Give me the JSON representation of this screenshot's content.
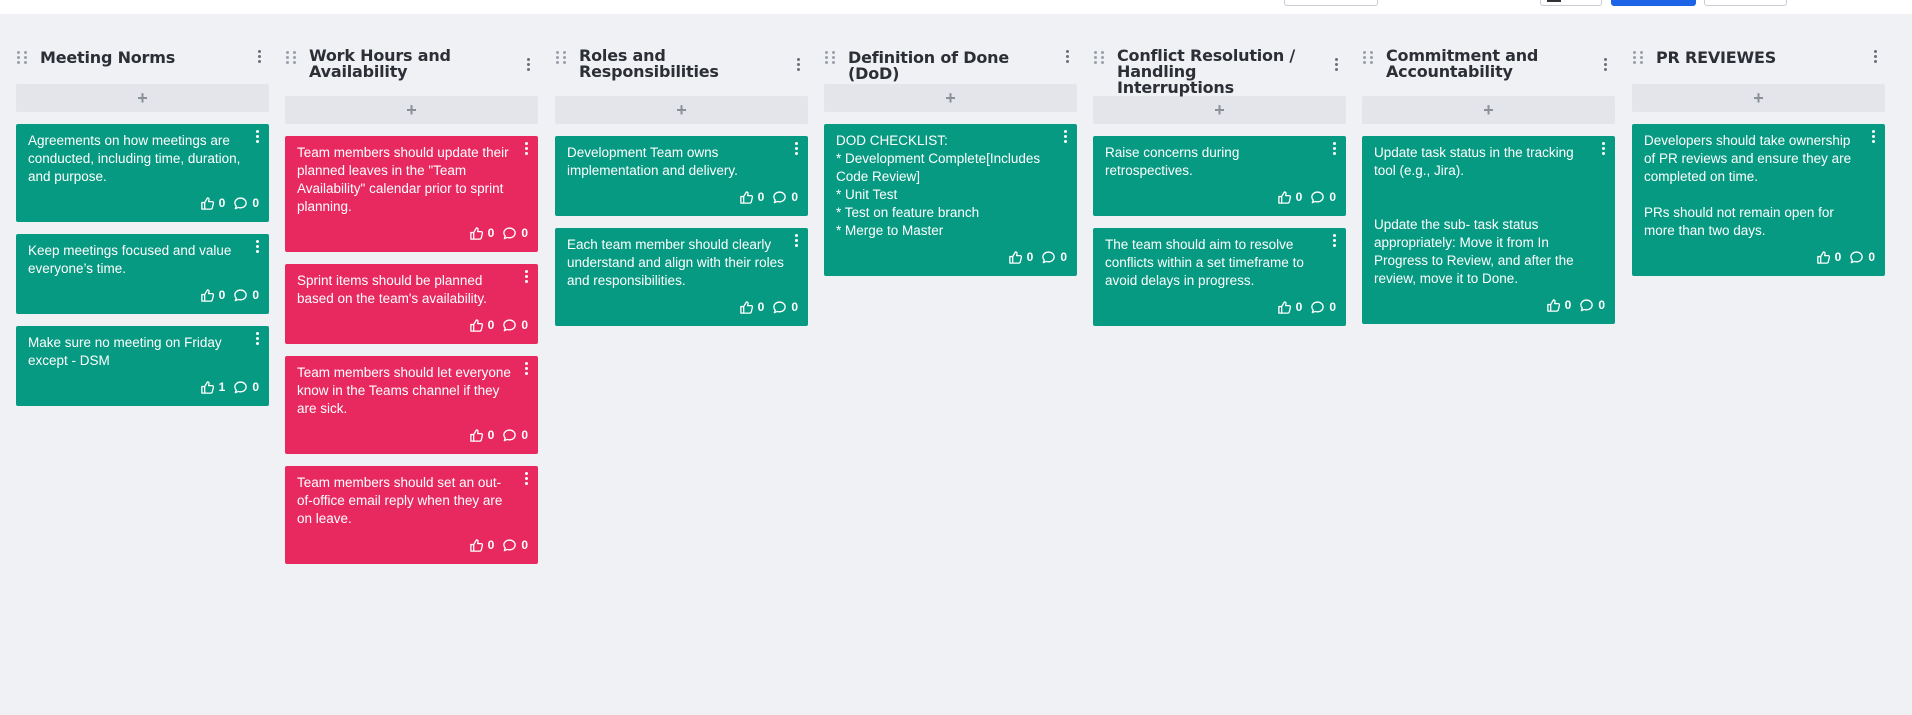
{
  "columns": [
    {
      "title": "Meeting Norms",
      "cards": [
        {
          "color": "green",
          "text": "Agreements on how meetings are conducted, including time, duration, and purpose.",
          "likes": "0",
          "comments": "0"
        },
        {
          "color": "green",
          "text": "Keep meetings focused and value everyone’s time.",
          "likes": "0",
          "comments": "0"
        },
        {
          "color": "green",
          "text": "Make sure no meeting on Friday except - DSM",
          "likes": "1",
          "comments": "0"
        }
      ]
    },
    {
      "title": "Work Hours and Availability",
      "cards": [
        {
          "color": "pink",
          "text": "Team members should update their planned leaves in the \"Team Availability\" calendar prior to sprint planning.",
          "likes": "0",
          "comments": "0"
        },
        {
          "color": "pink",
          "text": "Sprint items should be planned based on the team's availability.",
          "likes": "0",
          "comments": "0"
        },
        {
          "color": "pink",
          "text": "Team members should let everyone know in the Teams channel if they are sick.",
          "likes": "0",
          "comments": "0"
        },
        {
          "color": "pink",
          "text": "Team members should set an out-of-office email reply when they are on leave.",
          "likes": "0",
          "comments": "0"
        }
      ]
    },
    {
      "title": "Roles and Responsibilities",
      "cards": [
        {
          "color": "green",
          "text": "Development Team owns implementation and delivery.",
          "likes": "0",
          "comments": "0"
        },
        {
          "color": "green",
          "text": "Each team member should clearly understand and align with their roles and responsibilities.",
          "likes": "0",
          "comments": "0"
        }
      ]
    },
    {
      "title": "Definition of Done (DoD)",
      "cards": [
        {
          "color": "green",
          "text": "DOD CHECKLIST:\n* Development Complete[Includes Code Review]\n* Unit Test\n* Test on feature branch\n* Merge to Master",
          "likes": "0",
          "comments": "0"
        }
      ]
    },
    {
      "title": "Conflict Resolution / Handling Interruptions",
      "cards": [
        {
          "color": "green",
          "text": "Raise concerns during retrospectives.",
          "likes": "0",
          "comments": "0"
        },
        {
          "color": "green",
          "text": "The team should aim to resolve conflicts within a set timeframe to avoid delays in progress.",
          "likes": "0",
          "comments": "0"
        }
      ]
    },
    {
      "title": "Commitment and Accountability",
      "cards": [
        {
          "color": "green",
          "text": "Update task status in the tracking tool (e.g., Jira).\n\n\nUpdate the sub- task status appropriately: Move it from In Progress to Review, and after the review, move it to Done.",
          "likes": "0",
          "comments": "0"
        }
      ]
    },
    {
      "title": "PR REVIEWES",
      "cards": [
        {
          "color": "green",
          "text": "Developers should take ownership of PR reviews and ensure they are completed on time.\n\nPRs should not remain open for more than two days.",
          "likes": "0",
          "comments": "0"
        }
      ]
    }
  ],
  "add_label": "+",
  "colors": {
    "green": "#079a82",
    "pink": "#e8295f",
    "background": "#f0f1f5"
  }
}
